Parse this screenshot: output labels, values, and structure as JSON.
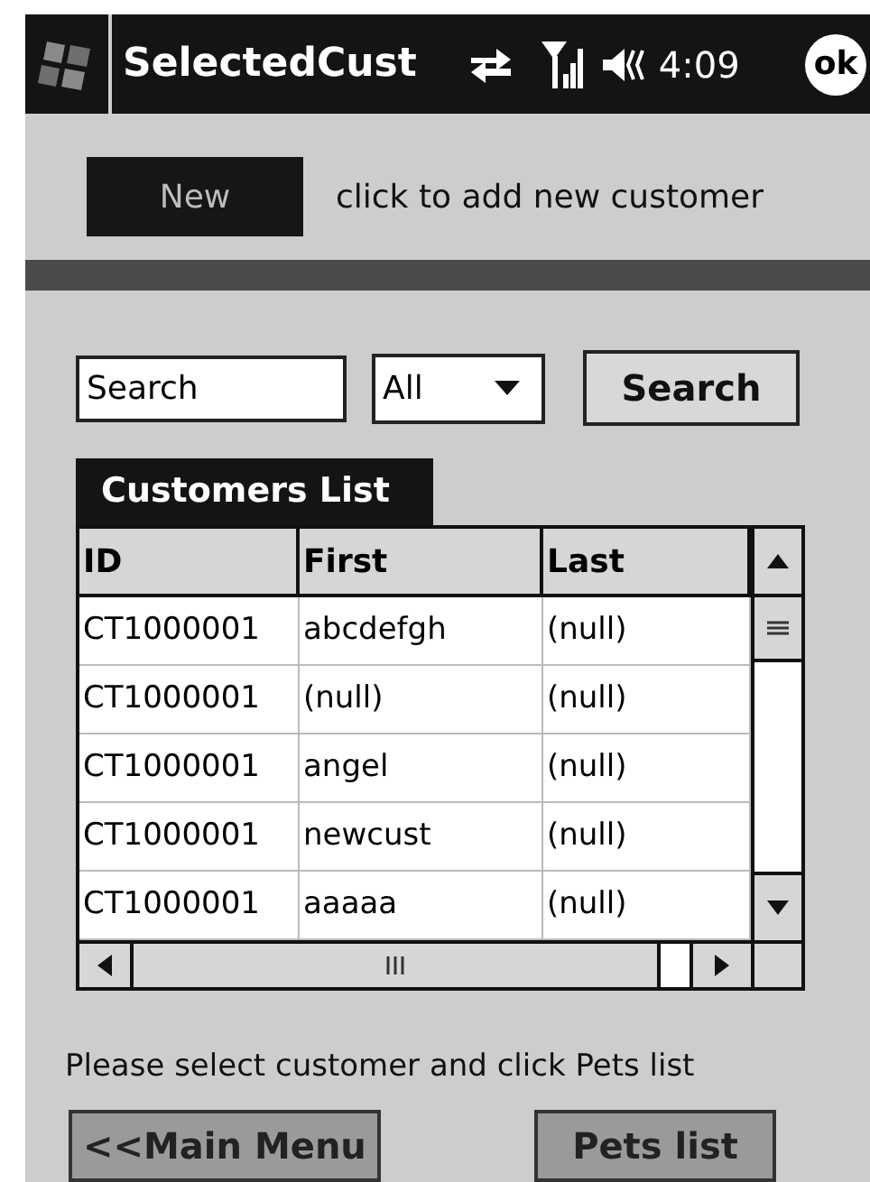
{
  "window": {
    "title": "SelectedCust",
    "time": "4:09",
    "ok_button": "ok"
  },
  "new_button": "New",
  "new_hint": "click to add new customer",
  "search": {
    "value": "Search",
    "filter": "All",
    "button": "Search"
  },
  "tab": "Customers List",
  "table": {
    "columns": [
      "ID",
      "First",
      "Last"
    ],
    "rows": [
      [
        "CT1000001",
        "abcdefgh",
        "(null)"
      ],
      [
        "CT1000001",
        "(null)",
        "(null)"
      ],
      [
        "CT1000001",
        "angel",
        "(null)"
      ],
      [
        "CT1000001",
        "newcust",
        "(null)"
      ],
      [
        "CT1000001",
        "aaaaa",
        "(null)"
      ]
    ]
  },
  "instruction": "Please select customer and click Pets list",
  "buttons": [
    "<<Main Menu",
    "Pets list"
  ]
}
